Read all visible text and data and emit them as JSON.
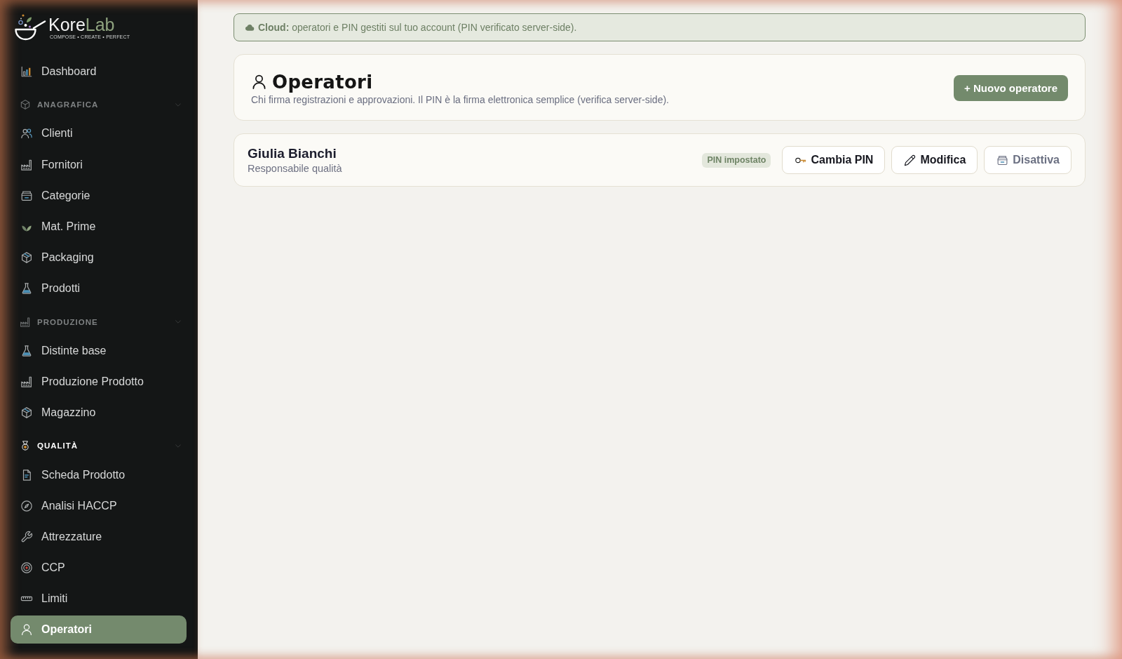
{
  "sidebar": {
    "logo": {
      "wordmark": "Kore",
      "wordmark_accent": "Lab",
      "tagline": "COMPOSE • CREATE • PERFECT"
    },
    "nav": [
      {
        "kind": "link",
        "label": "Dashboard",
        "selected": false
      },
      {
        "kind": "section",
        "label": "ANAGRAFICA",
        "active": false,
        "expanded": true,
        "children": [
          {
            "label": "Clienti",
            "selected": false
          },
          {
            "label": "Fornitori",
            "selected": false
          },
          {
            "label": "Categorie",
            "selected": false
          },
          {
            "label": "Mat. Prime",
            "selected": false
          },
          {
            "label": "Packaging",
            "selected": false
          },
          {
            "label": "Prodotti",
            "selected": false
          }
        ]
      },
      {
        "kind": "section",
        "label": "PRODUZIONE",
        "active": false,
        "expanded": true,
        "children": [
          {
            "label": "Distinte base",
            "selected": false
          },
          {
            "label": "Produzione Prodotto",
            "selected": false
          },
          {
            "label": "Magazzino",
            "selected": false
          }
        ]
      },
      {
        "kind": "section",
        "label": "QUALITÀ",
        "active": true,
        "expanded": true,
        "children": [
          {
            "label": "Scheda Prodotto",
            "selected": false
          },
          {
            "label": "Analisi HACCP",
            "selected": false
          },
          {
            "label": "Attrezzature",
            "selected": false
          },
          {
            "label": "CCP",
            "selected": false
          },
          {
            "label": "Limiti",
            "selected": false
          },
          {
            "label": "Operatori",
            "selected": true
          }
        ]
      }
    ]
  },
  "banner": {
    "text": "**Cloud:** operatori e PIN gestiti sul tuo account (PIN verificato server-side)."
  },
  "header": {
    "title": "Operatori",
    "subtitle": "Chi firma registrazioni e approvazioni. Il PIN è la firma elettronica semplice (verifica server-side).",
    "button": "+ Nuovo operatore"
  },
  "operators": [
    {
      "name": "Giulia Bianchi",
      "role": "Responsabile qualità",
      "badge": "PIN impostato",
      "actions": [
        {
          "label": "Cambia PIN",
          "kind": "default"
        },
        {
          "label": "Modifica",
          "kind": "default"
        },
        {
          "label": "Disattiva",
          "kind": "muted"
        }
      ]
    }
  ]
}
